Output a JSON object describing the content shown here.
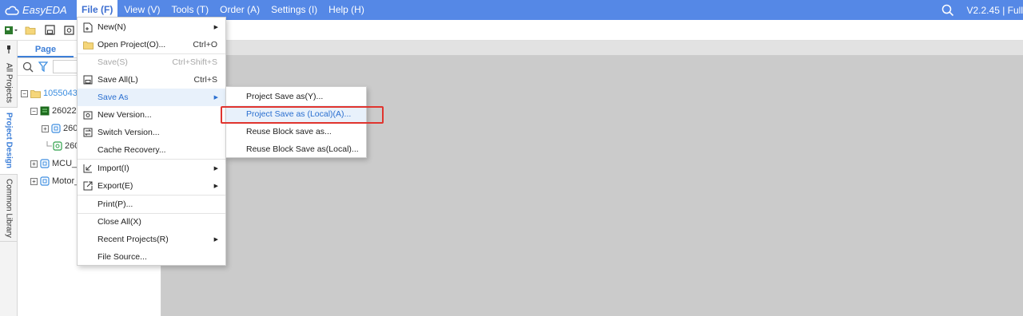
{
  "app": {
    "logo_text": "EasyEDA",
    "version": "V2.2.45 | Full"
  },
  "menubar": {
    "items": [
      "File (F)",
      "View (V)",
      "Tools (T)",
      "Order (A)",
      "Settings (I)",
      "Help (H)"
    ]
  },
  "vtabs": [
    "All Projects",
    "Project Design",
    "Common Library"
  ],
  "panel": {
    "tabs": [
      "Page"
    ],
    "tree": [
      "10550435",
      "260223",
      "260",
      "260",
      "MCU_E",
      "Motor_"
    ]
  },
  "file_menu": {
    "items": [
      {
        "label": "New(N)",
        "shortcut": "",
        "submenu": true
      },
      {
        "label": "Open Project(O)...",
        "shortcut": "Ctrl+O"
      },
      {
        "label": "Save(S)",
        "shortcut": "Ctrl+Shift+S",
        "disabled": true
      },
      {
        "label": "Save All(L)",
        "shortcut": "Ctrl+S"
      },
      {
        "label": "Save As",
        "shortcut": "",
        "submenu": true,
        "hover": true
      },
      {
        "label": "New Version...",
        "shortcut": ""
      },
      {
        "label": "Switch Version...",
        "shortcut": ""
      },
      {
        "label": "Cache Recovery...",
        "shortcut": ""
      },
      {
        "label": "Import(I)",
        "shortcut": "",
        "submenu": true
      },
      {
        "label": "Export(E)",
        "shortcut": "",
        "submenu": true
      },
      {
        "label": "Print(P)...",
        "shortcut": ""
      },
      {
        "label": "Close All(X)",
        "shortcut": ""
      },
      {
        "label": "Recent Projects(R)",
        "shortcut": "",
        "submenu": true
      },
      {
        "label": "File Source...",
        "shortcut": ""
      }
    ]
  },
  "save_as_submenu": {
    "items": [
      "Project Save as(Y)...",
      "Project Save as (Local)(A)...",
      "Reuse Block save as...",
      "Reuse Block Save as(Local)..."
    ],
    "highlighted": "Project Save as (Local)(A)..."
  },
  "colors": {
    "menubar": "#5588e6",
    "accent": "#3d7fd8",
    "highlight_border": "#e0342e"
  }
}
